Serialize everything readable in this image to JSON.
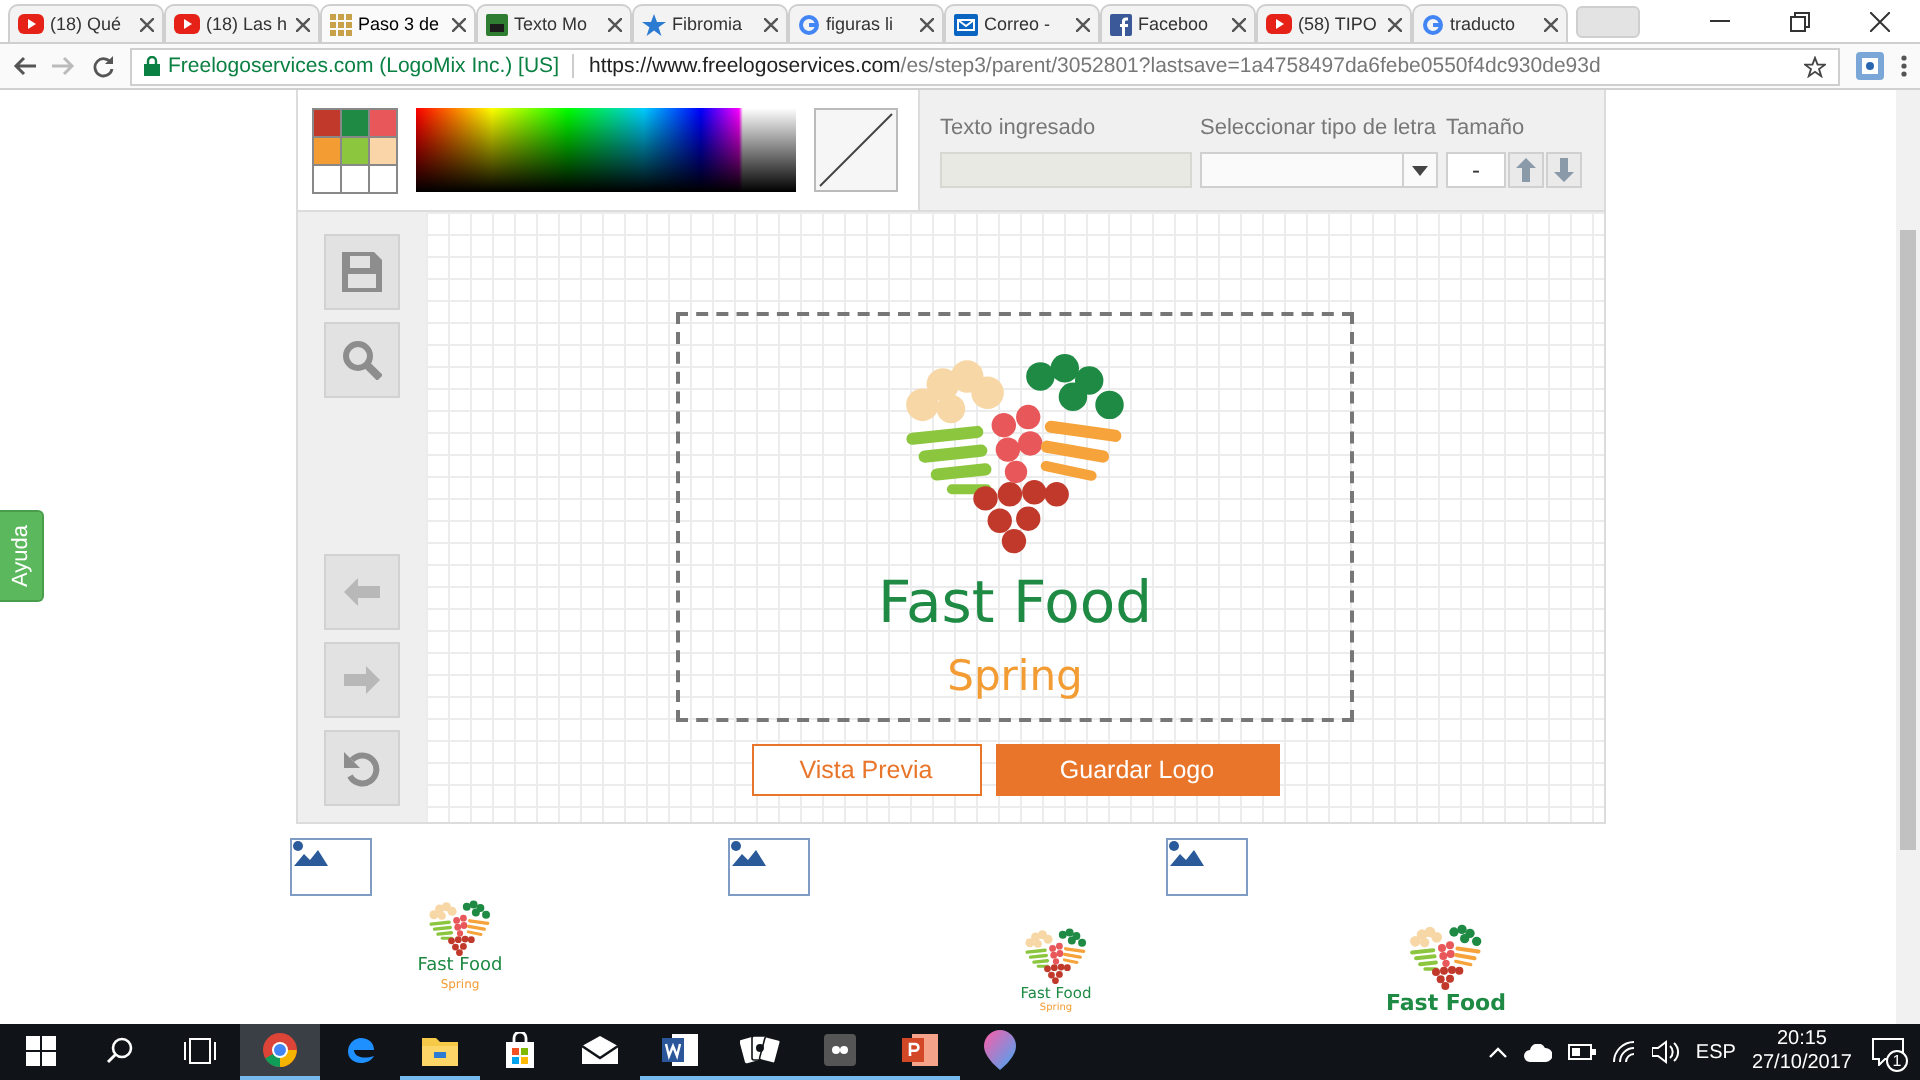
{
  "browser": {
    "tabs": [
      {
        "title": "(18) Qué",
        "kind": "youtube",
        "selected": false
      },
      {
        "title": "(18) Las h",
        "kind": "youtube",
        "selected": false
      },
      {
        "title": "Paso 3 de",
        "kind": "grid",
        "selected": true
      },
      {
        "title": "Texto Mo",
        "kind": "square",
        "selected": false
      },
      {
        "title": "Fibromia",
        "kind": "star",
        "selected": false
      },
      {
        "title": "figuras li",
        "kind": "google",
        "selected": false
      },
      {
        "title": "Correo -",
        "kind": "mail",
        "selected": false
      },
      {
        "title": "Faceboo",
        "kind": "facebook",
        "selected": false
      },
      {
        "title": "(58) TIPO",
        "kind": "youtube",
        "selected": false
      },
      {
        "title": "traducto",
        "kind": "google",
        "selected": false
      }
    ],
    "address": {
      "site_label": "Freelogoservices.com (LogoMix Inc.) [US]",
      "url_host": "https://www.freelogoservices.com",
      "url_path": "/es/step3/parent/3052801?lastsave=1a4758497da6febe0550f4dc930de93d"
    }
  },
  "help_tab": {
    "label": "Ayuda"
  },
  "editor": {
    "swatches": [
      {
        "color": "#c0392b"
      },
      {
        "color": "#1e8a44"
      },
      {
        "color": "#e8575a"
      },
      {
        "color": "#f39c33"
      },
      {
        "color": "#8cc63f"
      },
      {
        "color": "#f9d5a7"
      },
      {
        "color": "#ffffff"
      },
      {
        "color": "#ffffff"
      },
      {
        "color": "#ffffff"
      }
    ],
    "text_field": {
      "label": "Texto ingresado"
    },
    "font_select": {
      "label": "Seleccionar tipo de letra"
    },
    "size": {
      "label": "Tamaño",
      "value": "-"
    },
    "canvas": {
      "title": "Fast Food",
      "subtitle": "Spring"
    },
    "buttons": [
      {
        "label": "Vista Previa",
        "kind": "outline"
      },
      {
        "label": "Guardar Logo",
        "kind": "primary"
      }
    ]
  },
  "thumbnails": [
    {
      "title": "Fast Food",
      "subtitle": "Spring"
    },
    {
      "title": "Fast Food",
      "subtitle": "Spring"
    },
    {
      "title": "Fast Food"
    }
  ],
  "taskbar": {
    "apps": [
      {
        "kind": "chrome",
        "running": true,
        "selected": true
      },
      {
        "kind": "edge",
        "running": false,
        "selected": false
      },
      {
        "kind": "explorer",
        "running": true,
        "selected": false
      },
      {
        "kind": "store",
        "running": false,
        "selected": false
      },
      {
        "kind": "mail",
        "running": false,
        "selected": false
      },
      {
        "kind": "word",
        "running": true,
        "selected": false
      },
      {
        "kind": "cards",
        "running": true,
        "selected": false
      },
      {
        "kind": "app",
        "running": true,
        "selected": false
      },
      {
        "kind": "powerpoint",
        "running": true,
        "selected": false
      },
      {
        "kind": "paint",
        "running": false,
        "selected": false
      }
    ],
    "language": "ESP",
    "time": "20:15",
    "date": "27/10/2017",
    "notifications": "1"
  }
}
